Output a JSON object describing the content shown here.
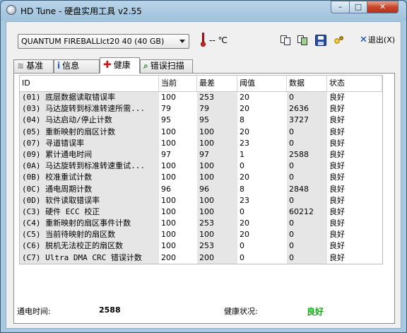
{
  "window": {
    "title": "HD Tune - 硬盘实用工具 v2.55",
    "minimize": "–",
    "maximize": "□",
    "close": "✕"
  },
  "toolbar": {
    "drive": "QUANTUM FIREBALLlct20 40 (40 GB)",
    "temperature": "-- ℃",
    "exit_label": "退出(X)",
    "icons": [
      "copy-icon",
      "copy-screenshot-icon",
      "save-icon",
      "options-icon",
      "exit-icon"
    ]
  },
  "tabs": [
    {
      "label": "基准",
      "icon": "benchmark-icon"
    },
    {
      "label": "信息",
      "icon": "info-icon"
    },
    {
      "label": "健康",
      "icon": "health-cross-icon",
      "active": true
    },
    {
      "label": "错误扫描",
      "icon": "error-scan-icon"
    }
  ],
  "table": {
    "headers": [
      "ID",
      "当前",
      "最差",
      "阈值",
      "数据",
      "状态"
    ],
    "rows": [
      [
        "(01) 底层数据读取错误率",
        "100",
        "253",
        "20",
        "0",
        "良好"
      ],
      [
        "(03) 马达旋转到标准转速所需...",
        "79",
        "79",
        "20",
        "2636",
        "良好"
      ],
      [
        "(04) 马达启动/停止计数",
        "95",
        "95",
        "8",
        "3727",
        "良好"
      ],
      [
        "(05) 重新映射的扇区计数",
        "100",
        "100",
        "20",
        "0",
        "良好"
      ],
      [
        "(07) 寻道错误率",
        "100",
        "100",
        "23",
        "0",
        "良好"
      ],
      [
        "(09) 累计通电时间",
        "97",
        "97",
        "1",
        "2588",
        "良好"
      ],
      [
        "(0A) 马达旋转到标准转速重试...",
        "100",
        "100",
        "0",
        "0",
        "良好"
      ],
      [
        "(0B) 校准重试计数",
        "100",
        "100",
        "20",
        "0",
        "良好"
      ],
      [
        "(0C) 通电周期计数",
        "96",
        "96",
        "8",
        "2848",
        "良好"
      ],
      [
        "(0D) 软件读取错误率",
        "100",
        "100",
        "23",
        "0",
        "良好"
      ],
      [
        "(C3) 硬件 ECC 校正",
        "100",
        "100",
        "0",
        "60212",
        "良好"
      ],
      [
        "(C4) 重新映射的扇区事件计数",
        "100",
        "253",
        "20",
        "0",
        "良好"
      ],
      [
        "(C5) 当前待映射的扇区数",
        "100",
        "100",
        "20",
        "0",
        "良好"
      ],
      [
        "(C6) 脱机无法校正的扇区数",
        "100",
        "253",
        "0",
        "0",
        "良好"
      ],
      [
        "(C7) Ultra DMA CRC 错误计数",
        "200",
        "200",
        "0",
        "0",
        "良好"
      ]
    ]
  },
  "footer": {
    "power_on_label": "通电时间:",
    "power_on_value": "2588",
    "health_label": "健康状况:",
    "health_value": "良好",
    "health_color": "#14a514"
  }
}
